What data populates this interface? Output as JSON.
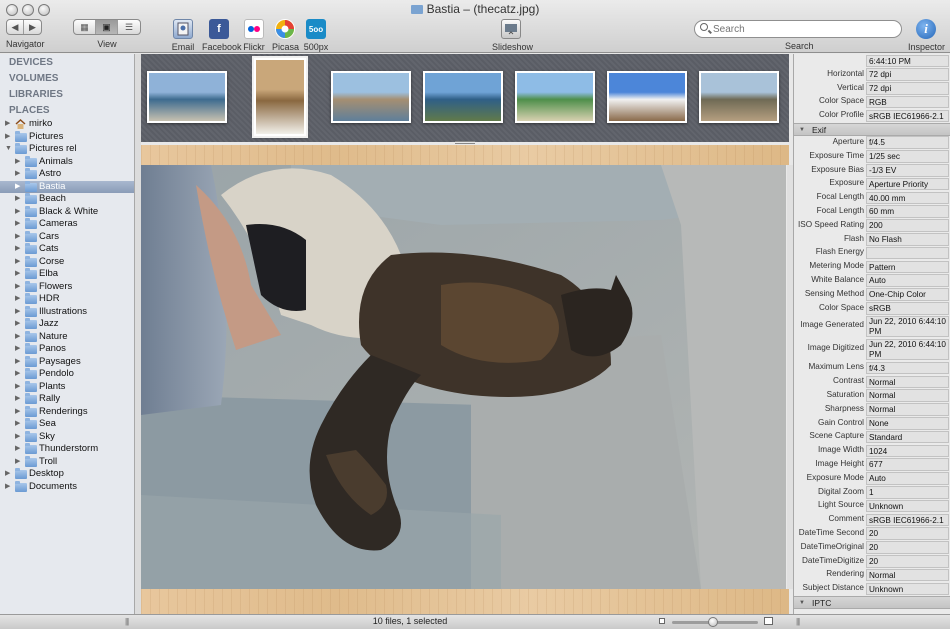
{
  "window": {
    "title": "Bastia – (thecatz.jpg)"
  },
  "toolbar": {
    "navigator_label": "Navigator",
    "view_label": "View",
    "share": [
      {
        "label": "Email",
        "icon": "email-icon"
      },
      {
        "label": "Facebook",
        "icon": "facebook-icon"
      },
      {
        "label": "Flickr",
        "icon": "flickr-icon"
      },
      {
        "label": "Picasa",
        "icon": "picasa-icon"
      },
      {
        "label": "500px",
        "icon": "500px-icon"
      }
    ],
    "slideshow_label": "Slideshow",
    "search_placeholder": "Search",
    "search_label": "Search",
    "inspector_label": "Inspector",
    "px500_glyph": "5oo",
    "facebook_glyph": "f"
  },
  "sidebar": {
    "sections": [
      "DEVICES",
      "VOLUMES",
      "LIBRARIES",
      "PLACES"
    ],
    "tree": [
      {
        "label": "mirko",
        "level": 0,
        "kind": "home",
        "expanded": false
      },
      {
        "label": "Pictures",
        "level": 0,
        "kind": "folder",
        "expanded": false
      },
      {
        "label": "Pictures rel",
        "level": 0,
        "kind": "folder",
        "expanded": true
      },
      {
        "label": "Animals",
        "level": 1,
        "kind": "folder",
        "expanded": false
      },
      {
        "label": "Astro",
        "level": 1,
        "kind": "folder",
        "expanded": false
      },
      {
        "label": "Bastia",
        "level": 1,
        "kind": "folder",
        "expanded": false,
        "selected": true
      },
      {
        "label": "Beach",
        "level": 1,
        "kind": "folder",
        "expanded": false
      },
      {
        "label": "Black & White",
        "level": 1,
        "kind": "folder",
        "expanded": false
      },
      {
        "label": "Cameras",
        "level": 1,
        "kind": "folder",
        "expanded": false
      },
      {
        "label": "Cars",
        "level": 1,
        "kind": "folder",
        "expanded": false
      },
      {
        "label": "Cats",
        "level": 1,
        "kind": "folder",
        "expanded": false
      },
      {
        "label": "Corse",
        "level": 1,
        "kind": "folder",
        "expanded": false
      },
      {
        "label": "Elba",
        "level": 1,
        "kind": "folder",
        "expanded": false
      },
      {
        "label": "Flowers",
        "level": 1,
        "kind": "folder",
        "expanded": false
      },
      {
        "label": "HDR",
        "level": 1,
        "kind": "folder",
        "expanded": false
      },
      {
        "label": "Illustrations",
        "level": 1,
        "kind": "folder",
        "expanded": false
      },
      {
        "label": "Jazz",
        "level": 1,
        "kind": "folder",
        "expanded": false
      },
      {
        "label": "Nature",
        "level": 1,
        "kind": "folder",
        "expanded": false
      },
      {
        "label": "Panos",
        "level": 1,
        "kind": "folder",
        "expanded": false
      },
      {
        "label": "Paysages",
        "level": 1,
        "kind": "folder",
        "expanded": false
      },
      {
        "label": "Pendolo",
        "level": 1,
        "kind": "folder",
        "expanded": false
      },
      {
        "label": "Plants",
        "level": 1,
        "kind": "folder",
        "expanded": false
      },
      {
        "label": "Rally",
        "level": 1,
        "kind": "folder",
        "expanded": false
      },
      {
        "label": "Renderings",
        "level": 1,
        "kind": "folder",
        "expanded": false
      },
      {
        "label": "Sea",
        "level": 1,
        "kind": "folder",
        "expanded": false
      },
      {
        "label": "Sky",
        "level": 1,
        "kind": "folder",
        "expanded": false
      },
      {
        "label": "Thunderstorm",
        "level": 1,
        "kind": "folder",
        "expanded": false
      },
      {
        "label": "Troll",
        "level": 1,
        "kind": "folder",
        "expanded": false
      },
      {
        "label": "Desktop",
        "level": 0,
        "kind": "folder",
        "expanded": false
      },
      {
        "label": "Documents",
        "level": 0,
        "kind": "folder",
        "expanded": false
      }
    ]
  },
  "filmstrip": {
    "thumbnails": [
      {
        "subject": "harbor",
        "selected": false
      },
      {
        "subject": "parasol",
        "selected": true
      },
      {
        "subject": "coast-cliff",
        "selected": false
      },
      {
        "subject": "bay",
        "selected": false
      },
      {
        "subject": "beach",
        "selected": false
      },
      {
        "subject": "windmill",
        "selected": false
      },
      {
        "subject": "mountain-road",
        "selected": false
      }
    ]
  },
  "main_image": {
    "subject": "tortoiseshell cat sitting next to a foot on stone pavement"
  },
  "inspector": {
    "top_rows": [
      {
        "key": "",
        "value": "6:44:10 PM"
      },
      {
        "key": "Horizontal",
        "value": "72 dpi"
      },
      {
        "key": "Vertical",
        "value": "72 dpi"
      },
      {
        "key": "Color Space",
        "value": "RGB"
      },
      {
        "key": "Color Profile",
        "value": "sRGB IEC61966-2.1"
      }
    ],
    "exif_header": "Exif",
    "exif_rows": [
      {
        "key": "Aperture",
        "value": "f/4.5"
      },
      {
        "key": "Exposure Time",
        "value": "1/25 sec"
      },
      {
        "key": "Exposure Bias",
        "value": "-1/3 EV"
      },
      {
        "key": "Exposure",
        "value": "Aperture Priority"
      },
      {
        "key": "Focal Length",
        "value": "40.00 mm"
      },
      {
        "key": "Focal Length",
        "value": "60 mm"
      },
      {
        "key": "ISO Speed Rating",
        "value": "200"
      },
      {
        "key": "Flash",
        "value": "No Flash"
      },
      {
        "key": "Flash Energy",
        "value": ""
      },
      {
        "key": "Metering Mode",
        "value": "Pattern"
      },
      {
        "key": "White Balance",
        "value": "Auto"
      },
      {
        "key": "Sensing Method",
        "value": "One-Chip Color"
      },
      {
        "key": "Color Space",
        "value": "sRGB"
      },
      {
        "key": "Image Generated",
        "value": "Jun 22, 2010 6:44:10 PM",
        "tall": true
      },
      {
        "key": "Image Digitized",
        "value": "Jun 22, 2010 6:44:10 PM",
        "tall": true
      },
      {
        "key": "Maximum Lens",
        "value": "f/4.3"
      },
      {
        "key": "Contrast",
        "value": "Normal"
      },
      {
        "key": "Saturation",
        "value": "Normal"
      },
      {
        "key": "Sharpness",
        "value": "Normal"
      },
      {
        "key": "Gain Control",
        "value": "None"
      },
      {
        "key": "Scene Capture",
        "value": "Standard"
      },
      {
        "key": "Image Width",
        "value": "1024"
      },
      {
        "key": "Image Height",
        "value": "677"
      },
      {
        "key": "Exposure Mode",
        "value": "Auto"
      },
      {
        "key": "Digital Zoom",
        "value": "1"
      },
      {
        "key": "Light Source",
        "value": "Unknown"
      },
      {
        "key": "Comment",
        "value": "sRGB IEC61966-2.1"
      },
      {
        "key": "DateTime Second",
        "value": "20"
      },
      {
        "key": "DateTimeOriginal",
        "value": "20"
      },
      {
        "key": "DateTimeDigitize",
        "value": "20"
      },
      {
        "key": "Rendering",
        "value": "Normal"
      },
      {
        "key": "Subject Distance",
        "value": "Unknown"
      }
    ],
    "iptc_header": "IPTC"
  },
  "status": {
    "text": "10 files, 1 selected",
    "zoom_level": 0.48
  },
  "colors": {
    "selection": "#8a9cb7",
    "folder": "#6b9bd3",
    "filmstrip_bg": "#5d6068",
    "wood": "#e0bd8c"
  }
}
